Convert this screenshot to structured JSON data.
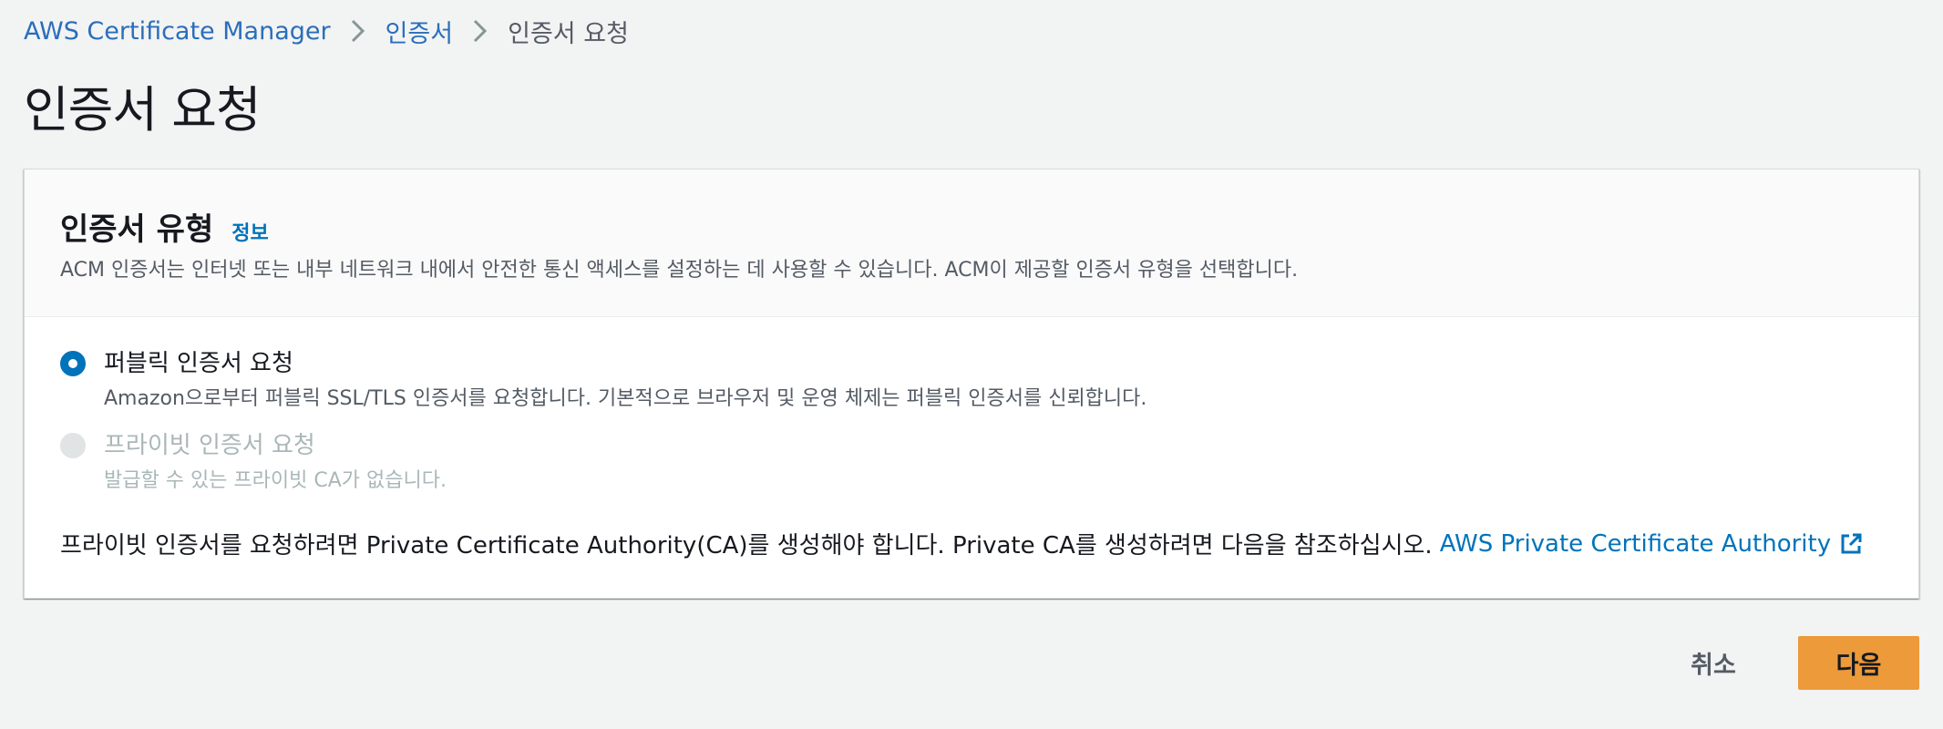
{
  "breadcrumb": {
    "items": [
      "AWS Certificate Manager",
      "인증서",
      "인증서 요청"
    ],
    "separator_icon": "chevron-right-icon"
  },
  "page_title": "인증서 요청",
  "certificate_type": {
    "title": "인증서 유형",
    "info_label": "정보",
    "description": "ACM 인증서는 인터넷 또는 내부 네트워크 내에서 안전한 통신 액세스를 설정하는 데 사용할 수 있습니다. ACM이 제공할 인증서 유형을 선택합니다.",
    "options": [
      {
        "label": "퍼블릭 인증서 요청",
        "description": "Amazon으로부터 퍼블릭 SSL/TLS 인증서를 요청합니다. 기본적으로 브라우저 및 운영 체제는 퍼블릭 인증서를 신뢰합니다.",
        "selected": true,
        "disabled": false
      },
      {
        "label": "프라이빗 인증서 요청",
        "description": "발급할 수 있는 프라이빗 CA가 없습니다.",
        "selected": false,
        "disabled": true
      }
    ],
    "note_text": "프라이빗 인증서를 요청하려면 Private Certificate Authority(CA)를 생성해야 합니다. Private CA를 생성하려면 다음을 참조하십시오.",
    "note_link": "AWS Private Certificate Authority",
    "note_link_icon": "external-link-icon"
  },
  "actions": {
    "cancel_label": "취소",
    "next_label": "다음"
  },
  "colors": {
    "link": "#0073bb",
    "primary_button": "#ec9a3a",
    "background": "#f2f3f3"
  }
}
